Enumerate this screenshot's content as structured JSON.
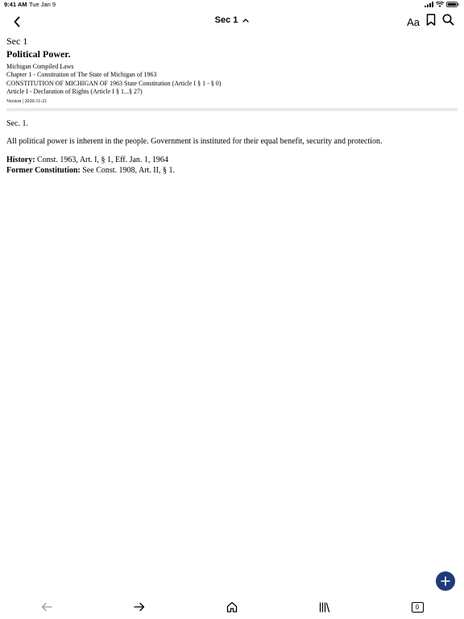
{
  "status": {
    "time": "9:41 AM",
    "date": "Tue Jan 9"
  },
  "nav": {
    "title": "Sec 1",
    "font_button": "Aa"
  },
  "doc": {
    "sec_label": "Sec 1",
    "title": "Political Power.",
    "meta": [
      "Michigan Compiled Laws",
      "Chapter 1 - Constitution of The State of Michigan of 1963",
      "CONSTITUTION OF MICHIGAN OF 1963 State Constitution (Article I § 1 - § 0)",
      "Article I - Declaration of Rights (Article I § 1...§ 27)"
    ],
    "version": "Version | 2020-11-21",
    "body_sec": "Sec. 1.",
    "body_text": "All political power is inherent in the people. Government is instituted for their equal benefit, security and protection.",
    "history_label": "History:",
    "history_value": " Const. 1963, Art. I, § 1, Eff. Jan. 1, 1964",
    "former_label": "Former Constitution:",
    "former_value": " See Const. 1908, Art. II, § 1."
  },
  "toolbar": {
    "tab_count": "0"
  },
  "colors": {
    "fab": "#1e3a7a",
    "divider": "#e9e9e9"
  },
  "icons": [
    "back-chevron-icon",
    "chevron-up-icon",
    "bookmark-icon",
    "search-icon",
    "plus-icon",
    "arrow-left-icon",
    "arrow-right-icon",
    "home-icon",
    "library-icon",
    "tabs-icon"
  ]
}
